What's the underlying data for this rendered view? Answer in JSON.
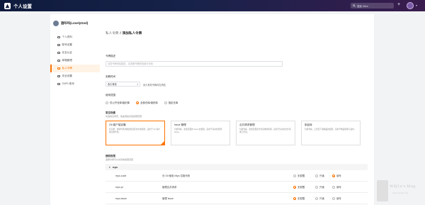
{
  "app": {
    "title": "个人设置",
    "search_placeholder": "搜索 Gitee",
    "plus": "+",
    "caret": "▾"
  },
  "colors": {
    "accent": "#fe7300",
    "topbar": "#0f1b3d"
  },
  "profile": {
    "name": "逍咔咔(LonelyGod)"
  },
  "sidebar": {
    "items": [
      {
        "label": "个人资料",
        "icon": "user-icon"
      },
      {
        "label": "账号设置",
        "icon": "settings-icon"
      },
      {
        "label": "实名认证",
        "icon": "id-icon"
      },
      {
        "label": "邮箱管理",
        "icon": "mail-icon"
      },
      {
        "label": "私人令牌",
        "icon": "key-icon",
        "active": true
      },
      {
        "label": "安全设置",
        "icon": "shield-icon"
      },
      {
        "label": "TAPD 账号",
        "icon": "link-icon"
      }
    ]
  },
  "breadcrumb": {
    "parent": "私人令牌",
    "separator": "/",
    "current": "添加私人令牌"
  },
  "form": {
    "desc_label": "令牌描述",
    "desc_placeholder": "请您令牌添加描述，请说明令牌的用途与作用",
    "expiry_label": "到期时间",
    "expiry_value": "永久有效",
    "expiry_note": "永久有效令牌存在风险",
    "scope_label": "使用范围",
    "scope_options": [
      {
        "label": "仅公开仓库/组织库",
        "checked": false
      },
      {
        "label": "全部仓库/组织库",
        "checked": true
      },
      {
        "label": "指定仓库",
        "checked": false
      }
    ],
    "presets_label": "常见场景",
    "presets_hint": "勾选常见场景，快速添加对应权限范围",
    "presets": [
      {
        "title": "Git 客户端克隆",
        "desc": "仅克隆、拉取代码并推送到远程仓库的权限，适用于 Git 客户端克隆代码。",
        "selected": true
      },
      {
        "title": "Issue 管理",
        "desc": "包括查看、新建及更新 Issue 的权限，适用于自动化管理 Issue。",
        "selected": false
      },
      {
        "title": "合并请求管理",
        "desc": "包括查看、新建及更新合并请求的权限，适用于自动化合并请求工作流。",
        "selected": false
      },
      {
        "title": "制品库",
        "desc": "包括查看、上传及下载制品的权限，适用于制品管理与发布。",
        "selected": false
      }
    ],
    "perm_label": "授权权限",
    "perm_hint": "选择令牌可以访问的权限范围",
    "perm_group": "repo",
    "permissions": [
      {
        "key": "repo-code",
        "desc": "仓 Git 使用 https 拉取代码",
        "level": "write"
      },
      {
        "key": "repo-pr",
        "desc": "管理合并请求",
        "level": "none"
      },
      {
        "key": "repo-issue",
        "desc": "管理 Issue",
        "level": "none"
      }
    ],
    "level_labels": [
      "无权限",
      "只读",
      "读写"
    ]
  },
  "watermark": {
    "text": "W4J1e's blog",
    "url": "https://w4j1e.xyz"
  }
}
